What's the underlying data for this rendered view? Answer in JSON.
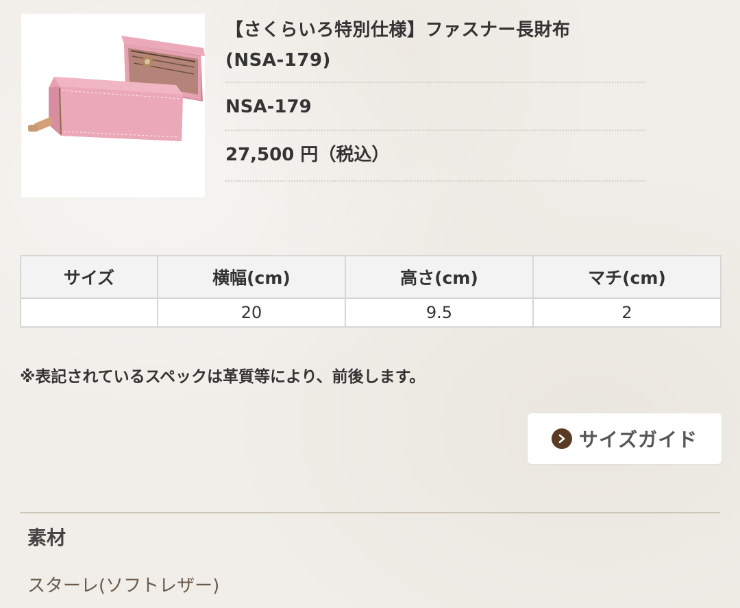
{
  "product": {
    "name_line1": "【さくらいろ特別仕様】ファスナー長財布",
    "name_line2": "(NSA-179)",
    "code": "NSA-179",
    "price": "27,500 円（税込）",
    "image_color": "#e9a2b4"
  },
  "spec_table": {
    "headers": [
      "サイズ",
      "横幅(cm)",
      "高さ(cm)",
      "マチ(cm)"
    ],
    "row": [
      "",
      "20",
      "9.5",
      "2"
    ]
  },
  "note": "※表記されているスペックは革質等により、前後します。",
  "size_guide": {
    "label": "サイズガイド",
    "icon": "chevron-right-circle-icon",
    "icon_color": "#5a3a24"
  },
  "material": {
    "heading": "素材",
    "value": "スターレ(ソフトレザー)"
  }
}
